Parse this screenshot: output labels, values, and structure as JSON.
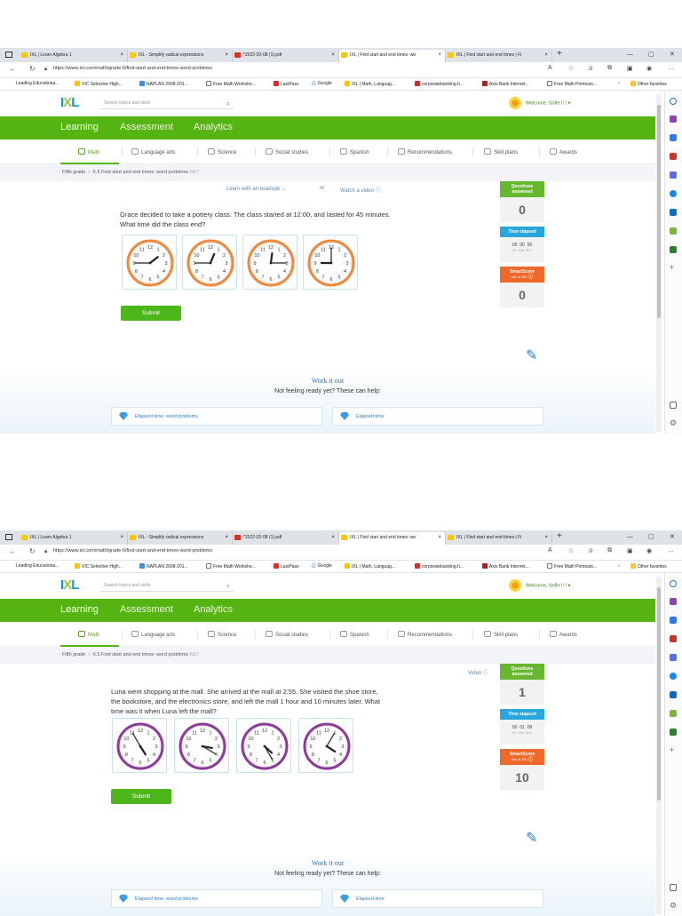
{
  "screens": [
    {
      "tabs": [
        {
          "label": "IXL | Learn Algebra 1",
          "icon": "ixl"
        },
        {
          "label": "IXL - Simplify radical expressions",
          "icon": "ixl"
        },
        {
          "label": "*2022-02-08 (1).pdf",
          "icon": "pdf"
        },
        {
          "label": "IXL | Find start and end times: wo",
          "icon": "ixl"
        },
        {
          "label": "IXL | Find start and end times | Fi",
          "icon": "ixl"
        }
      ],
      "url": "https://www.ixl.com/math/grade-5/find-start-and-end-times-word-problems",
      "favorites": [
        "Leading Educationa...",
        "VIC Selective High...",
        "NAPLAN 2008-201...",
        "Free Math Workshe...",
        "LastPass",
        "Google",
        "IXL | Math, Languag...",
        "corporatebanking.h...",
        "Axis Bank Internet...",
        "Free Math Printouts...",
        "Other favorites"
      ],
      "search_placeholder": "Search topics and skills",
      "welcome": "Welcome, Sofie !!.!",
      "main_tabs": [
        "Learning",
        "Assessment",
        "Analytics"
      ],
      "subjects": [
        "Math",
        "Language arts",
        "Science",
        "Social studies",
        "Spanish",
        "Recommendations",
        "Skill plans",
        "Awards"
      ],
      "breadcrumb": {
        "grade": "Fifth grade",
        "skill": "X.5 Find start and end times: word problems",
        "code": "NX7"
      },
      "help_example": "Learn with an example",
      "help_or": "or",
      "help_video": "Watch a video",
      "question_line1": "Grace decided to take a pottery class. The class started at 12:00, and lasted for 45 minutes.",
      "question_line2": "What time did the class end?",
      "question_line3": "",
      "clocks": [
        {
          "h": 1,
          "m": 45
        },
        {
          "h": 12,
          "m": 45
        },
        {
          "h": 12,
          "m": 15
        },
        {
          "h": 9,
          "m": 0
        }
      ],
      "clock_color": "#f0883a",
      "submit": "Submit",
      "questions_answered_label": "Questions answered",
      "questions_answered": "0",
      "time_elapsed_label": "Time elapsed",
      "time": {
        "hr": "00",
        "min": "00",
        "sec": "56"
      },
      "time_units": {
        "hr": "HR",
        "min": "MIN",
        "sec": "SEC"
      },
      "smartscore_label": "SmartScore",
      "smartscore_sub": "out of 100",
      "smartscore": "0",
      "work_it_out": "Work it out",
      "not_ready": "Not feeling ready yet? These can help:",
      "help_cards": [
        "Elapsed time: word problems",
        "Elapsed time"
      ]
    },
    {
      "tabs": [
        {
          "label": "IXL | Learn Algebra 1",
          "icon": "ixl"
        },
        {
          "label": "IXL - Simplify radical expressions",
          "icon": "ixl"
        },
        {
          "label": "*2022-02-08 (1).pdf",
          "icon": "pdf"
        },
        {
          "label": "IXL | Find start and end times: wo",
          "icon": "ixl"
        },
        {
          "label": "IXL | Find start and end times | Fi",
          "icon": "ixl"
        }
      ],
      "url": "https://www.ixl.com/math/grade-5/find-start-and-end-times-word-problems",
      "favorites": [
        "Leading Educationa...",
        "VIC Selective High...",
        "NAPLAN 2008-201...",
        "Free Math Workshe...",
        "LastPass",
        "Google",
        "IXL | Math, Languag...",
        "corporatebanking.h...",
        "Axis Bank Internet...",
        "Free Math Printouts...",
        "Other favorites"
      ],
      "search_placeholder": "Search topics and skills",
      "welcome": "Welcome, Sofie !!.!",
      "main_tabs": [
        "Learning",
        "Assessment",
        "Analytics"
      ],
      "subjects": [
        "Math",
        "Language arts",
        "Science",
        "Social studies",
        "Spanish",
        "Recommendations",
        "Skill plans",
        "Awards"
      ],
      "breadcrumb": {
        "grade": "Fifth grade",
        "skill": "X.5 Find start and end times: word problems",
        "code": "NX7"
      },
      "help_example": "",
      "help_or": "",
      "help_video": "Video",
      "question_line1": "Luna went shopping at the mall. She arrived at the mall at 2:55. She visited the shoe store,",
      "question_line2": "the bookstore, and the electronics store, and left the mall 1 hour and 10 minutes later. What",
      "question_line3": "time was it when Luna left the mall?",
      "clocks": [
        {
          "h": 4,
          "m": 55
        },
        {
          "h": 3,
          "m": 20
        },
        {
          "h": 4,
          "m": 25
        },
        {
          "h": 4,
          "m": 5
        }
      ],
      "clock_color": "#8e3a9d",
      "submit": "Submit",
      "questions_answered_label": "Questions answered",
      "questions_answered": "1",
      "time_elapsed_label": "Time elapsed",
      "time": {
        "hr": "00",
        "min": "01",
        "sec": "09"
      },
      "time_units": {
        "hr": "HR",
        "min": "MIN",
        "sec": "SEC"
      },
      "smartscore_label": "SmartScore",
      "smartscore_sub": "out of 100",
      "smartscore": "10",
      "work_it_out": "Work it out",
      "not_ready": "Not feeling ready yet? These can help:",
      "help_cards": [
        "Elapsed time: word problems",
        "Elapsed time"
      ]
    }
  ],
  "colors": {
    "ixl_green": "#56b412",
    "questions_green": "#66b92e",
    "time_blue": "#2aa6de",
    "score_orange": "#f0692b"
  }
}
